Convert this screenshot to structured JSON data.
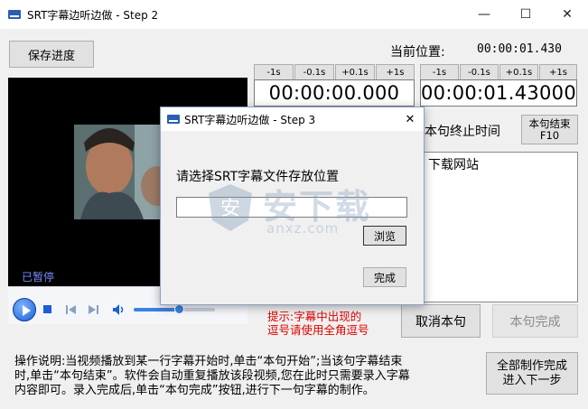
{
  "window": {
    "title": "SRT字幕边听边做 - Step 2",
    "minimize_glyph": "—",
    "maximize_glyph": "☐",
    "close_glyph": "✕"
  },
  "toolbar": {
    "save_progress_label": "保存进度"
  },
  "position": {
    "label": "当前位置:",
    "value": "00:00:01.430"
  },
  "start_time": {
    "value": "00:00:00.000",
    "adjust_buttons": [
      "-1s",
      "-0.1s",
      "+0.1s",
      "+1s"
    ]
  },
  "end_time": {
    "value": "00:00:01.43000",
    "adjust_buttons": [
      "-1s",
      "-0.1s",
      "+0.1s",
      "+1s"
    ]
  },
  "video": {
    "status": "已暂停",
    "volume_level": 0.55,
    "seek_progress": 0.2
  },
  "sentence": {
    "end_label": "本句终止时间",
    "end_button_line1": "本句结束",
    "end_button_line2": "F10",
    "subtitle_text": "下载网站"
  },
  "hint": {
    "line1": "提示:字幕中出现的",
    "line2": "逗号请使用全角逗号"
  },
  "actions": {
    "cancel_label": "取消本句",
    "finish_label": "本句完成",
    "all_done_line1": "全部制作完成",
    "all_done_line2": "进入下一步"
  },
  "instructions": {
    "line1": "操作说明:当视频播放到某一行字幕开始时,单击“本句开始”;当该句字幕结束",
    "line2": "时,单击“本句结束”。软件会自动重复播放该段视频,您在此时只需要录入字幕",
    "line3": "内容即可。录入完成后,单击“本句完成”按钮,进行下一句字幕的制作。"
  },
  "dialog": {
    "title": "SRT字幕边听边做 - Step 3",
    "close_glyph": "✕",
    "prompt": "请选择SRT字幕文件存放位置",
    "path_value": "",
    "browse_label": "浏览",
    "done_label": "完成"
  },
  "watermark": {
    "text": "安下载",
    "subtext": "anxz.com"
  },
  "colors": {
    "hint_red": "#e00000",
    "paused_blue": "#7a8cff",
    "player_blue": "#1b5fd1"
  }
}
